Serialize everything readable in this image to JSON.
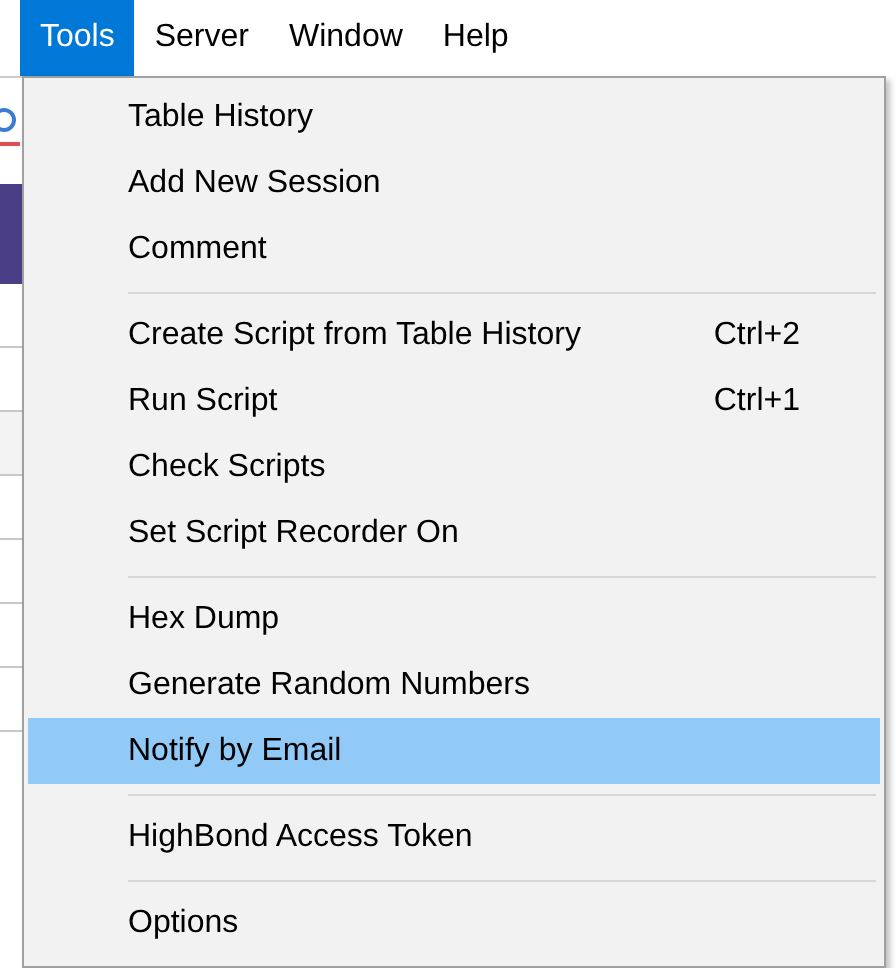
{
  "menu_bar": [
    {
      "label": "Tools",
      "selected": true
    },
    {
      "label": "Server",
      "selected": false
    },
    {
      "label": "Window",
      "selected": false
    },
    {
      "label": "Help",
      "selected": false
    }
  ],
  "dropdown": [
    {
      "kind": "item",
      "label": "Table History",
      "highlighted": false
    },
    {
      "kind": "item",
      "label": "Add New Session",
      "highlighted": false
    },
    {
      "kind": "item",
      "label": "Comment",
      "highlighted": false
    },
    {
      "kind": "separator"
    },
    {
      "kind": "item",
      "label": "Create Script from Table History",
      "shortcut": "Ctrl+2",
      "highlighted": false
    },
    {
      "kind": "item",
      "label": "Run Script",
      "shortcut": "Ctrl+1",
      "highlighted": false
    },
    {
      "kind": "item",
      "label": "Check Scripts",
      "highlighted": false
    },
    {
      "kind": "item",
      "label": "Set Script Recorder On",
      "highlighted": false
    },
    {
      "kind": "separator"
    },
    {
      "kind": "item",
      "label": "Hex Dump",
      "highlighted": false
    },
    {
      "kind": "item",
      "label": "Generate Random Numbers",
      "highlighted": false
    },
    {
      "kind": "item",
      "label": "Notify by Email",
      "highlighted": true
    },
    {
      "kind": "separator"
    },
    {
      "kind": "item",
      "label": "HighBond Access Token",
      "highlighted": false
    },
    {
      "kind": "separator"
    },
    {
      "kind": "item",
      "label": "Options",
      "highlighted": false
    }
  ]
}
